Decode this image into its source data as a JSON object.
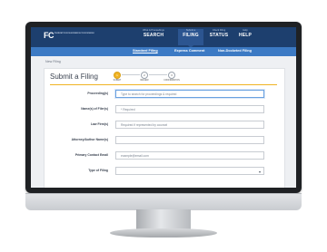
{
  "header": {
    "logo_mark": "FC",
    "logo_name": "Federal Communications Commission",
    "nav": [
      {
        "small": "What & Proceedings",
        "big": "SEARCH"
      },
      {
        "small": "Submit a",
        "big": "FILING"
      },
      {
        "small": "Check Filing",
        "big": "STATUS"
      },
      {
        "small": "Help",
        "big": "HELP"
      }
    ]
  },
  "subnav": {
    "items": [
      "Standard Filing",
      "Express Comment",
      "Non-Docketed Filing"
    ]
  },
  "breadcrumb": "New Filing",
  "form": {
    "title": "Submit a Filing",
    "steps": [
      "SUBMIT",
      "REVIEW",
      "CONFIRMATION"
    ],
    "fields": [
      {
        "label": "Proceeding(s)",
        "value": "Type to search for proceedings & required"
      },
      {
        "label": "Name(s) of Filer(s)",
        "value": "* Required"
      },
      {
        "label": "Law Firm(s)",
        "value": "Required if represented by counsel"
      },
      {
        "label": "Attorney/Author Name(s)",
        "value": ""
      },
      {
        "label": "Primary Contact Email",
        "value": "example@email.com"
      },
      {
        "label": "Type of Filing",
        "value": ""
      }
    ]
  }
}
